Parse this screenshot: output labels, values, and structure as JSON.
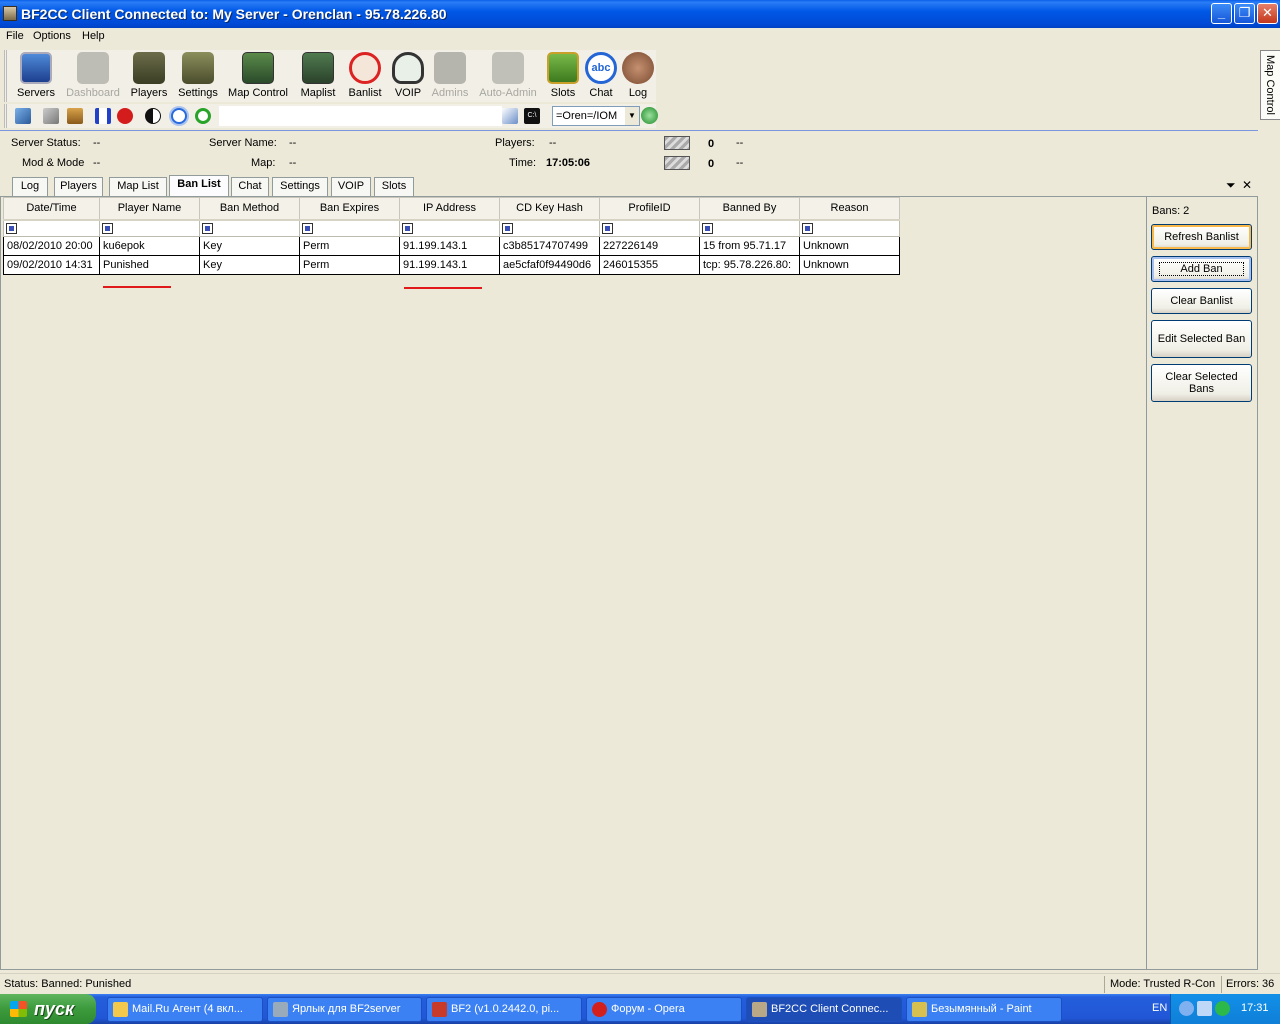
{
  "window": {
    "title": "BF2CC Client Connected to: My Server - Orenclan - 95.78.226.80"
  },
  "menu": [
    "File",
    "Options",
    "Help"
  ],
  "toolbar": [
    {
      "label": "Servers",
      "icon": "servers-icon",
      "enabled": true
    },
    {
      "label": "Dashboard",
      "icon": "dashboard-icon",
      "enabled": false
    },
    {
      "label": "Players",
      "icon": "players-icon",
      "enabled": true
    },
    {
      "label": "Settings",
      "icon": "tank-icon",
      "enabled": true
    },
    {
      "label": "Map Control",
      "icon": "map-icon",
      "enabled": true
    },
    {
      "label": "Maplist",
      "icon": "maplist-icon",
      "enabled": true
    },
    {
      "label": "Banlist",
      "icon": "banlist-icon",
      "enabled": true
    },
    {
      "label": "VOIP",
      "icon": "headset-icon",
      "enabled": true
    },
    {
      "label": "Admins",
      "icon": "admin-icon",
      "enabled": false
    },
    {
      "label": "Auto-Admin",
      "icon": "robot-icon",
      "enabled": false
    },
    {
      "label": "Slots",
      "icon": "slots-icon",
      "enabled": true
    },
    {
      "label": "Chat",
      "icon": "chat-bubble-icon",
      "enabled": true
    },
    {
      "label": "Log",
      "icon": "log-icon",
      "enabled": true
    }
  ],
  "command_bar": {
    "player_select": "=Oren=/IOM"
  },
  "side_tab": "Map Control",
  "server_info": {
    "status_label": "Server Status:",
    "status_value": "--",
    "mode_label": "Mod & Mode",
    "mode_value": "--",
    "name_label": "Server Name:",
    "name_value": "--",
    "map_label": "Map:",
    "map_value": "--",
    "players_label": "Players:",
    "players_value": "--",
    "time_label": "Time:",
    "time_value": "17:05:06",
    "team1_count": "0",
    "team1_value": "--",
    "team2_count": "0",
    "team2_value": "--"
  },
  "tabs": [
    "Log",
    "Players",
    "Map List",
    "Ban List",
    "Chat",
    "Settings",
    "VOIP",
    "Slots"
  ],
  "active_tab": "Ban List",
  "banlist": {
    "columns": [
      "Date/Time",
      "Player Name",
      "Ban Method",
      "Ban Expires",
      "IP Address",
      "CD Key Hash",
      "ProfileID",
      "Banned By",
      "Reason"
    ],
    "rows": [
      [
        "08/02/2010 20:00",
        "ku6epok",
        "Key",
        "Perm",
        "91.199.143.1",
        "c3b85174707499",
        "227226149",
        "15 from 95.71.17",
        "Unknown"
      ],
      [
        "09/02/2010 14:31",
        "Punished",
        "Key",
        "Perm",
        "91.199.143.1",
        "ae5cfaf0f94490d6",
        "246015355",
        "tcp: 95.78.226.80:",
        "Unknown"
      ]
    ]
  },
  "right_panel": {
    "bans_count": "Bans: 2",
    "buttons": [
      "Refresh Banlist",
      "Add Ban",
      "Clear Banlist",
      "Edit Selected Ban",
      "Clear Selected Bans"
    ]
  },
  "status": {
    "left": "Status: Banned: Punished",
    "mode": "Mode: Trusted R-Con",
    "errors": "Errors: 36"
  },
  "taskbar": {
    "start": "пуск",
    "tasks": [
      "Mail.Ru Агент (4 вкл...",
      "Ярлык для BF2server",
      "BF2 (v1.0.2442.0, pi...",
      "Форум - Opera",
      "BF2CC Client Connec...",
      "Безымянный - Paint"
    ],
    "lang": "EN",
    "clock": "17:31"
  },
  "colors": {
    "accent": "#0054e3",
    "highlight": "#e01a1a",
    "tab_active": "#fcfcfe"
  }
}
